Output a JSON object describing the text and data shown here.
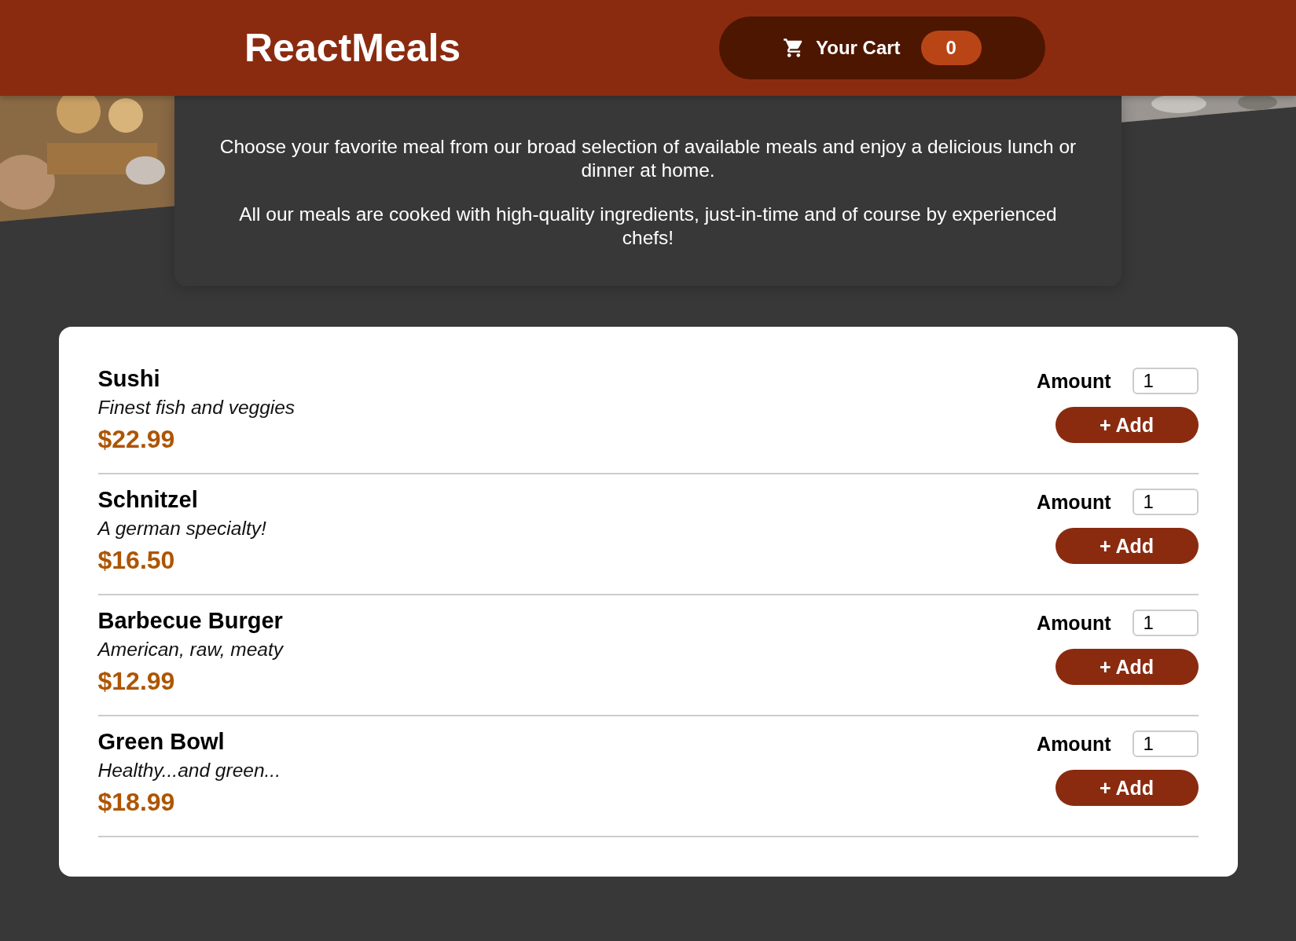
{
  "header": {
    "logo": "ReactMeals",
    "cart": {
      "label": "Your Cart",
      "count": "0"
    }
  },
  "intro": {
    "paragraphs": [
      "Choose your favorite meal from our broad selection of available meals and enjoy a delicious lunch or dinner at home.",
      "All our meals are cooked with high-quality ingredients, just-in-time and of course by experienced chefs!"
    ]
  },
  "meals": [
    {
      "name": "Sushi",
      "description": "Finest fish and veggies",
      "price": "$22.99",
      "amount_label": "Amount",
      "amount": "1",
      "button": "+ Add"
    },
    {
      "name": "Schnitzel",
      "description": "A german specialty!",
      "price": "$16.50",
      "amount_label": "Amount",
      "amount": "1",
      "button": "+ Add"
    },
    {
      "name": "Barbecue Burger",
      "description": "American, raw, meaty",
      "price": "$12.99",
      "amount_label": "Amount",
      "amount": "1",
      "button": "+ Add"
    },
    {
      "name": "Green Bowl",
      "description": "Healthy...and green...",
      "price": "$18.99",
      "amount_label": "Amount",
      "amount": "1",
      "button": "+ Add"
    }
  ]
}
